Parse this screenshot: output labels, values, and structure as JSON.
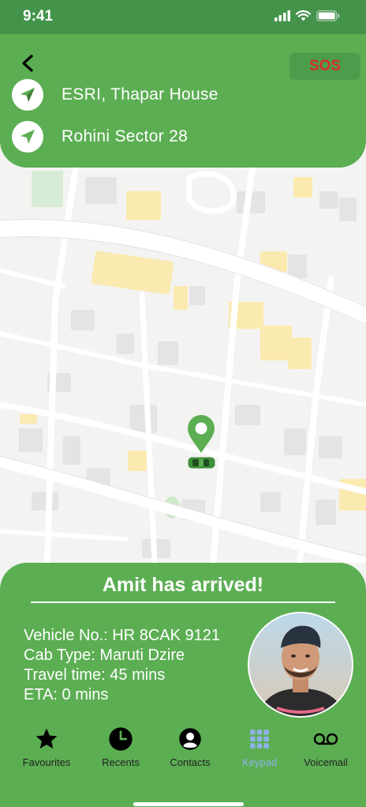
{
  "status_bar": {
    "time": "9:41"
  },
  "header": {
    "sos_label": "SOS",
    "pickup": "ESRI, Thapar House",
    "destination": "Rohini Sector 28"
  },
  "ride": {
    "headline": "Amit has arrived!",
    "vehicle": "Vehicle No.: HR 8CAK 9121",
    "cab_type": "Cab Type: Maruti Dzire",
    "travel_time": "Travel time: 45 mins",
    "eta": "ETA: 0 mins"
  },
  "nav": {
    "items": [
      {
        "label": "Favourites",
        "icon": "star-icon"
      },
      {
        "label": "Recents",
        "icon": "clock-icon"
      },
      {
        "label": "Contacts",
        "icon": "person-circle-icon"
      },
      {
        "label": "Keypad",
        "icon": "keypad-icon"
      },
      {
        "label": "Voicemail",
        "icon": "voicemail-icon"
      }
    ]
  },
  "colors": {
    "primary_green": "#5cae53",
    "status_green": "#43934a",
    "sos_red": "#d62f29"
  }
}
